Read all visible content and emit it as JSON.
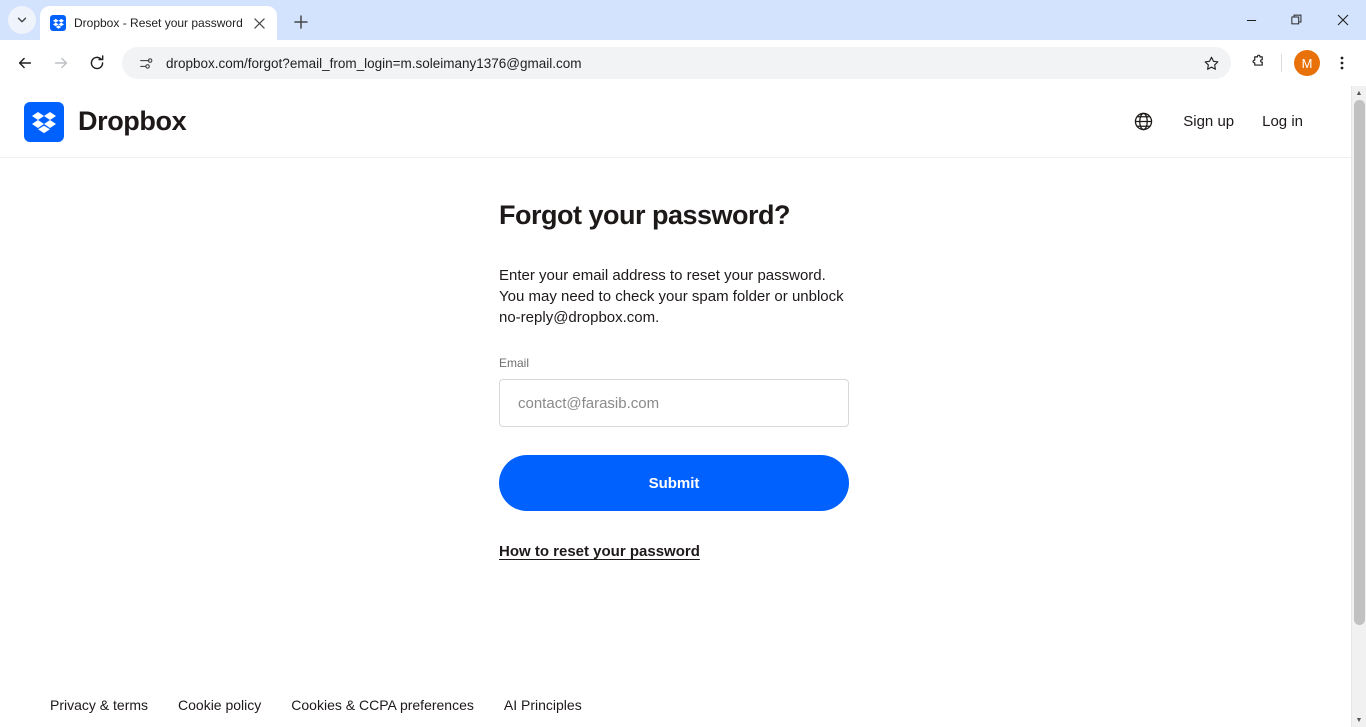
{
  "browser": {
    "tab_search_icon": "chevron-down-icon",
    "tab": {
      "favicon": "dropbox-favicon",
      "title": "Dropbox - Reset your password",
      "close_icon": "close-icon"
    },
    "new_tab_label": "+",
    "window_controls": {
      "minimize": "—",
      "maximize": "❐",
      "close": "✕"
    },
    "nav": {
      "back_icon": "back-arrow-icon",
      "forward_icon": "forward-arrow-icon",
      "reload_icon": "reload-icon"
    },
    "omnibox": {
      "site_icon": "page-settings-icon",
      "url": "dropbox.com/forgot?email_from_login=m.soleimany1376@gmail.com",
      "star_icon": "bookmark-star-icon"
    },
    "extensions_icon": "extensions-puzzle-icon",
    "profile_initial": "M",
    "menu_icon": "kebab-menu-icon"
  },
  "site_header": {
    "logo_icon": "dropbox-logo-icon",
    "brand_name": "Dropbox",
    "globe_icon": "globe-icon",
    "sign_up_label": "Sign up",
    "log_in_label": "Log in"
  },
  "main": {
    "title": "Forgot your password?",
    "description": "Enter your email address to reset your password. You may need to check your spam folder or unblock no-reply@dropbox.com.",
    "email_label": "Email",
    "email_value": "",
    "email_placeholder": "contact@farasib.com",
    "submit_label": "Submit",
    "help_link_label": "How to reset your password"
  },
  "footer": {
    "links": [
      {
        "label": "Privacy & terms"
      },
      {
        "label": "Cookie policy"
      },
      {
        "label": "Cookies & CCPA preferences"
      },
      {
        "label": "AI Principles"
      }
    ]
  },
  "colors": {
    "brand_blue": "#0061ff",
    "tabstrip_blue": "#d3e3fd",
    "text_dark": "#1e1919",
    "avatar_orange": "#e8710a"
  }
}
